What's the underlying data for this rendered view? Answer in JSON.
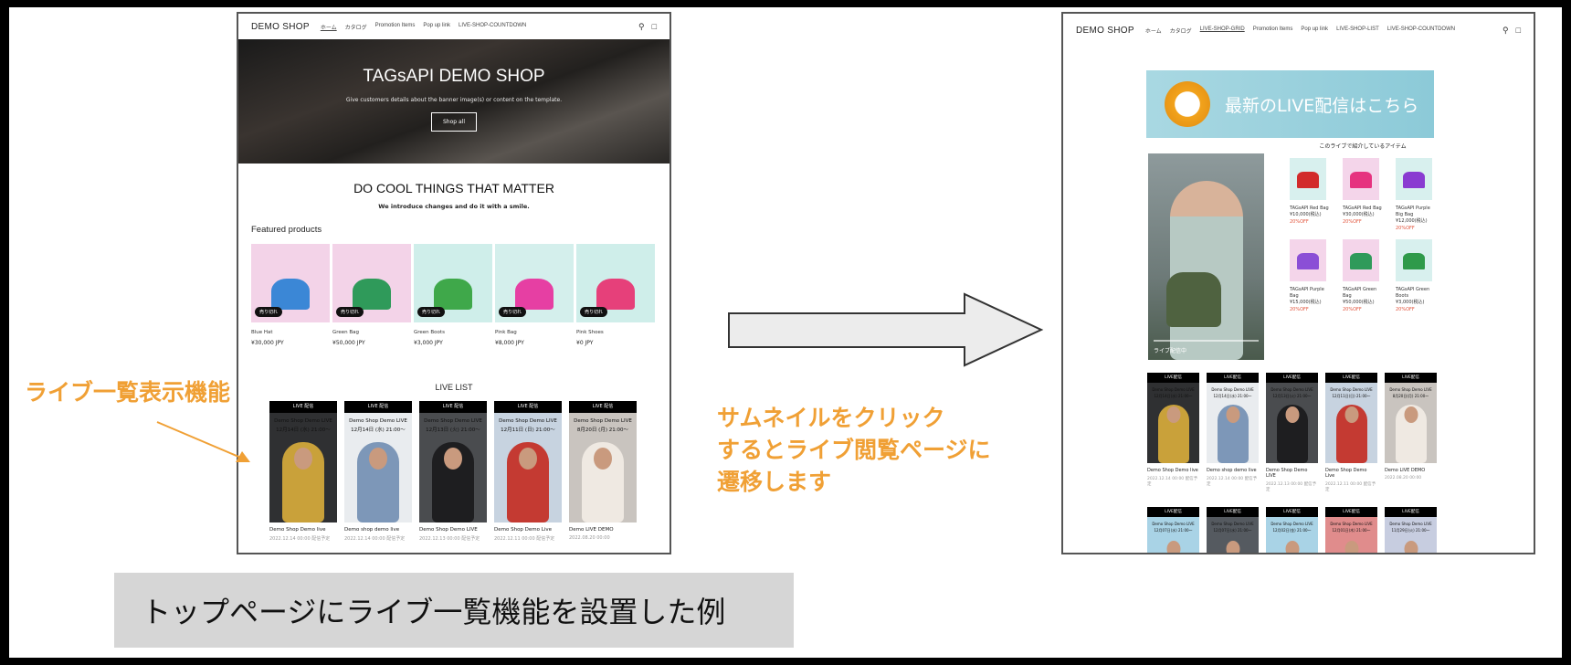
{
  "left_screen": {
    "header": {
      "logo": "DEMO SHOP",
      "nav": [
        "ホーム",
        "カタログ",
        "Promotion Items",
        "Pop up link",
        "LIVE-SHOP-COUNTDOWN"
      ],
      "active_index": 0
    },
    "hero": {
      "title": "TAGsAPI DEMO SHOP",
      "subtitle": "Give customers details about the banner image(s) or content on the template.",
      "button": "Shop all"
    },
    "headline": "DO COOL THINGS THAT MATTER",
    "headline_sub": "We introduce changes and do it with a smile.",
    "featured_title": "Featured products",
    "products": [
      {
        "name": "Blue Hat",
        "price": "¥30,000 JPY",
        "badge": "売り切れ",
        "bg": "#f3d3e8",
        "color": "#3b87d6"
      },
      {
        "name": "Green Bag",
        "price": "¥50,000 JPY",
        "badge": "売り切れ",
        "bg": "#f3d3e8",
        "color": "#2f9a5a"
      },
      {
        "name": "Green Boots",
        "price": "¥3,000 JPY",
        "badge": "売り切れ",
        "bg": "#cfeeea",
        "color": "#3fa84a"
      },
      {
        "name": "Pink Bag",
        "price": "¥8,000 JPY",
        "badge": "売り切れ",
        "bg": "#d4efec",
        "color": "#e63fa3"
      },
      {
        "name": "Pink Shoes",
        "price": "¥0 JPY",
        "badge": "売り切れ",
        "bg": "#cfeeea",
        "color": "#e6407a"
      }
    ],
    "live_title": "LIVE LIST",
    "lives": [
      {
        "bar": "LIVE 配信",
        "caption1": "Demo Shop Demo LIVE",
        "caption2": "12月14日 (水) 21:00～",
        "name": "Demo Shop Demo live",
        "date": "2022.12.14 00:00 配信予定",
        "bg": "#2f3032",
        "outfit": "#c9a13a"
      },
      {
        "bar": "LIVE 配信",
        "caption1": "Demo Shop Demo LIVE",
        "caption2": "12月14日 (水) 21:00～",
        "name": "Demo shop demo live",
        "date": "2022.12.14 00:00 配信予定",
        "bg": "#e9ecef",
        "outfit": "#7d97b8"
      },
      {
        "bar": "LIVE 配信",
        "caption1": "Demo Shop Demo LIVE",
        "caption2": "12月13日 (火) 21:00～",
        "name": "Demo Shop Demo LIVE",
        "date": "2022.12.13 00:00 配信予定",
        "bg": "#4a4c4f",
        "outfit": "#1e1e20"
      },
      {
        "bar": "LIVE 配信",
        "caption1": "Demo Shop Demo LIVE",
        "caption2": "12月11日 (日) 21:00～",
        "name": "Demo Shop Demo Live",
        "date": "2022.12.11 00:00 配信予定",
        "bg": "#c7d3e0",
        "outfit": "#c43a32"
      },
      {
        "bar": "LIVE 配信",
        "caption1": "Demo Shop Demo LIVE",
        "caption2": "8月20日 (月) 21:00～",
        "name": "Demo LIVE DEMO",
        "date": "2022.08.20 00:00",
        "bg": "#c9c4bf",
        "outfit": "#efe9e2"
      }
    ]
  },
  "right_screen": {
    "header": {
      "logo": "DEMO SHOP",
      "nav": [
        "ホーム",
        "カタログ",
        "LIVE-SHOP-GRID",
        "Promotion Items",
        "Pop up link",
        "LIVE-SHOP-LIST",
        "LIVE-SHOP-COUNTDOWN"
      ],
      "active_index": 2
    },
    "banner_text": "最新のLIVE配信はこちら",
    "video_time": "ライブ配信中",
    "items_title": "このライブで紹介しているアイテム",
    "items": [
      {
        "name": "TAGsAPI Red Bag",
        "price": "¥10,000(税込)",
        "off": "20%OFF",
        "bg": "#d8f0ee",
        "color": "#d22b2b"
      },
      {
        "name": "TAGsAPI Red Bag",
        "price": "¥30,000(税込)",
        "off": "20%OFF",
        "bg": "#f4d5ea",
        "color": "#e6327f"
      },
      {
        "name": "TAGsAPI Purple Big Bag",
        "price": "¥12,000(税込)",
        "off": "20%OFF",
        "bg": "#d8f0ee",
        "color": "#8a3bd1"
      },
      {
        "name": "TAGsAPI Purple Bag",
        "price": "¥15,000(税込)",
        "off": "20%OFF",
        "bg": "#f4d5ea",
        "color": "#8b4fd6"
      },
      {
        "name": "TAGsAPI Green Bag",
        "price": "¥50,000(税込)",
        "off": "20%OFF",
        "bg": "#f4d5ea",
        "color": "#2f9a5a"
      },
      {
        "name": "TAGsAPI Green Boots",
        "price": "¥3,000(税込)",
        "off": "20%OFF",
        "bg": "#d8f0ee",
        "color": "#2f9a4a"
      }
    ],
    "lives": [
      {
        "bar": "LIVE配信",
        "caption1": "Demo Shop Demo LIVE",
        "caption2": "12月14日(水) 21:00～",
        "name": "Demo Shop Demo live",
        "date": "2022.12.14 00:00 配信予定",
        "bg": "#2f3032",
        "outfit": "#c9a13a"
      },
      {
        "bar": "LIVE配信",
        "caption1": "Demo Shop Demo LIVE",
        "caption2": "12月14日(水) 21:00～",
        "name": "Demo shop demo live",
        "date": "2022.12.14 00:00 配信予定",
        "bg": "#e9ecef",
        "outfit": "#7d97b8"
      },
      {
        "bar": "LIVE配信",
        "caption1": "Demo Shop Demo LIVE",
        "caption2": "12月13日(火) 21:00～",
        "name": "Demo Shop Demo LIVE",
        "date": "2022.12.13 00:00 配信予定",
        "bg": "#4a4c4f",
        "outfit": "#1e1e20"
      },
      {
        "bar": "LIVE配信",
        "caption1": "Demo Shop Demo LIVE",
        "caption2": "12月11日(日) 21:00～",
        "name": "Demo Shop Demo Live",
        "date": "2022.12.11 00:00 配信予定",
        "bg": "#c7d3e0",
        "outfit": "#c43a32"
      },
      {
        "bar": "LIVE配信",
        "caption1": "Demo Shop Demo LIVE",
        "caption2": "8月20日(月) 21:00～",
        "name": "Demo LIVE DEMO",
        "date": "2022.08.20 00:00",
        "bg": "#c9c4bf",
        "outfit": "#efe9e2"
      }
    ],
    "lives_row2": [
      {
        "bar": "LIVE配信",
        "caption1": "Demo Shop Demo LIVE",
        "caption2": "12月07日(水) 21:00～",
        "bg": "#a9d3e6",
        "outfit": "#a9d3e6"
      },
      {
        "bar": "LIVE配信",
        "caption1": "Demo Shop Demo LIVE",
        "caption2": "12月07日(水) 21:00～",
        "bg": "#555a60",
        "outfit": "#555a60"
      },
      {
        "bar": "LIVE配信",
        "caption1": "Demo Shop Demo LIVE",
        "caption2": "12月02日(金) 21:00～",
        "bg": "#a9d3e6",
        "outfit": "#a9d3e6"
      },
      {
        "bar": "LIVE配信",
        "caption1": "Demo Shop Demo LIVE",
        "caption2": "12月01日(木) 21:00～",
        "bg": "#e08c8c",
        "outfit": "#e08c8c"
      },
      {
        "bar": "LIVE配信",
        "caption1": "Demo Shop Demo LIVE",
        "caption2": "11月29日(火) 21:00～",
        "bg": "#c7cde0",
        "outfit": "#c7cde0"
      }
    ]
  },
  "annotations": {
    "left_label": "ライブ一覧表示機能",
    "right_label_line1": "サムネイルをクリック",
    "right_label_line2": "するとライブ閲覧ページに",
    "right_label_line3": "遷移します",
    "caption": "トップページにライブ一覧機能を設置した例",
    "accent_color": "#f0a035"
  }
}
